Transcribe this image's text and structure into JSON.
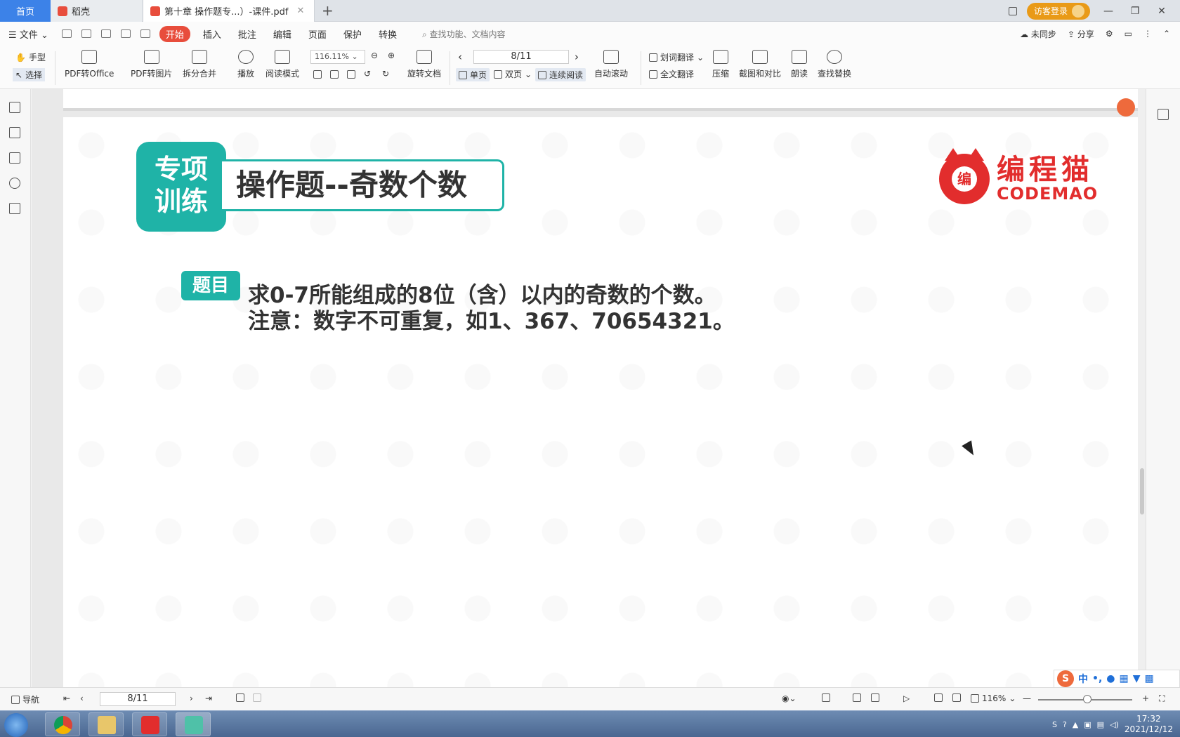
{
  "tabs": {
    "home": "首页",
    "daoke": "稻壳",
    "pdf": "第十章 操作题专...）-课件.pdf",
    "add": "+"
  },
  "titlebar_right": {
    "login": "访客登录"
  },
  "menu": {
    "file": "文件",
    "start": "开始",
    "insert": "插入",
    "annotate": "批注",
    "edit": "编辑",
    "page": "页面",
    "protect": "保护",
    "convert": "转换",
    "search_placeholder": "查找功能、文档内容",
    "unsync": "未同步",
    "share": "分享"
  },
  "ribbon": {
    "hand": "手型",
    "select": "选择",
    "pdf_to_office": "PDF转Office",
    "pdf_to_image": "PDF转图片",
    "split_merge": "拆分合并",
    "play": "播放",
    "read_mode": "阅读模式",
    "zoom": "116.11%",
    "rotate_doc": "旋转文档",
    "page_indicator": "8/11",
    "single_page": "单页",
    "double_page": "双页",
    "continuous": "连续阅读",
    "auto_scroll": "自动滚动",
    "word_translate": "划词翻译",
    "full_translate": "全文翻译",
    "compress": "压缩",
    "screenshot_compare": "截图和对比",
    "read_aloud": "朗读",
    "find_replace": "查找替换"
  },
  "document": {
    "badge": "专项\n训练",
    "badge_line1": "专项",
    "badge_line2": "训练",
    "title": "操作题--奇数个数",
    "logo_cn": "编程猫",
    "logo_en": "CODEMAO",
    "logo_mark": "编",
    "question_tag": "题目",
    "question_line1": "求0-7所能组成的8位（含）以内的奇数的个数。",
    "question_line2": "注意：数字不可重复，如1、367、70654321。"
  },
  "statusbar": {
    "nav": "导航",
    "page": "8/11",
    "zoom": "116%"
  },
  "ime": {
    "mode": "中"
  },
  "clock": {
    "time": "17:32",
    "date": "2021/12/12"
  },
  "colors": {
    "teal": "#1fb3a7",
    "brand_red": "#e22d2d",
    "accent_tab": "#3c82e8",
    "start_btn": "#e84d3c"
  }
}
